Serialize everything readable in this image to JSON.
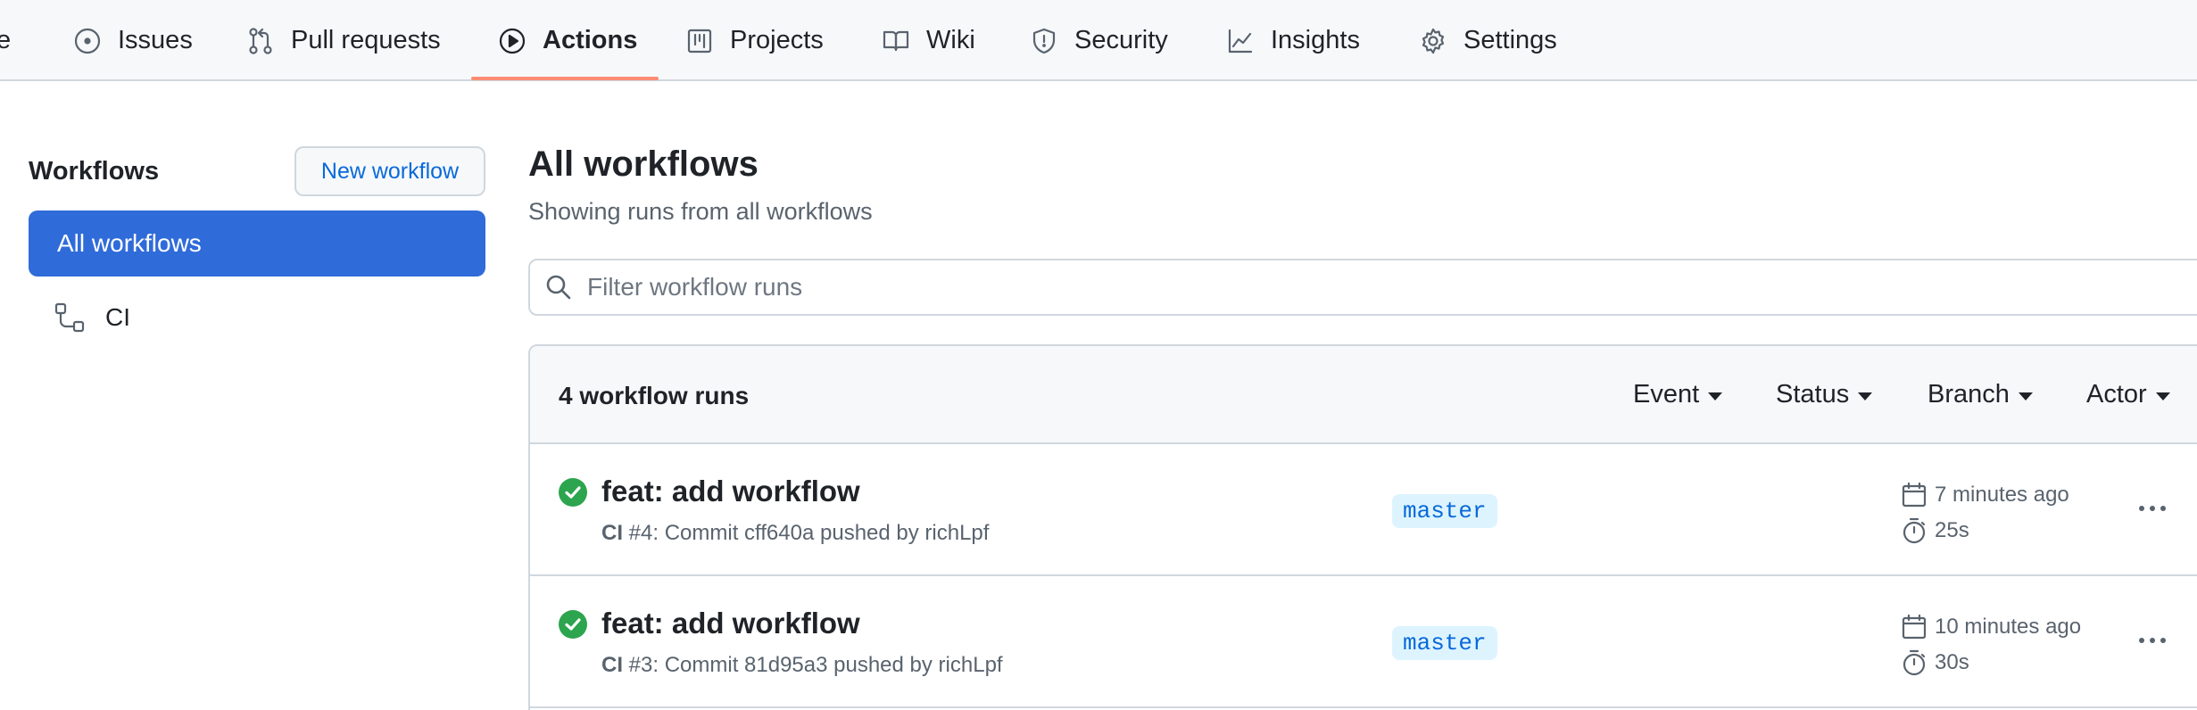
{
  "nav": {
    "cut_label": "e",
    "items": [
      {
        "label": "Issues",
        "icon": "issue-circle-icon"
      },
      {
        "label": "Pull requests",
        "icon": "pull-request-icon"
      },
      {
        "label": "Actions",
        "icon": "play-circle-icon",
        "active": true
      },
      {
        "label": "Projects",
        "icon": "project-board-icon"
      },
      {
        "label": "Wiki",
        "icon": "book-icon"
      },
      {
        "label": "Security",
        "icon": "shield-icon"
      },
      {
        "label": "Insights",
        "icon": "graph-icon"
      },
      {
        "label": "Settings",
        "icon": "gear-icon"
      }
    ]
  },
  "sidebar": {
    "title": "Workflows",
    "new_workflow_label": "New workflow",
    "items": [
      {
        "label": "All workflows",
        "selected": true
      },
      {
        "label": "CI",
        "icon": "workflow-icon"
      }
    ]
  },
  "main": {
    "title": "All workflows",
    "subtitle": "Showing runs from all workflows",
    "filter_placeholder": "Filter workflow runs",
    "runs_count": "4 workflow runs",
    "filters": [
      "Event",
      "Status",
      "Branch",
      "Actor"
    ],
    "runs": [
      {
        "title": "feat: add workflow",
        "workflow": "CI",
        "meta": " #4: Commit cff640a pushed by richLpf",
        "branch": "master",
        "when": "7 minutes ago",
        "duration": "25s",
        "status": "success"
      },
      {
        "title": "feat: add workflow",
        "workflow": "CI",
        "meta": " #3: Commit 81d95a3 pushed by richLpf",
        "branch": "master",
        "when": "10 minutes ago",
        "duration": "30s",
        "status": "success"
      }
    ]
  },
  "colors": {
    "accent": "#2f6bd9",
    "link": "#0969da",
    "success": "#1a7f37",
    "underline": "#fd8c73"
  }
}
